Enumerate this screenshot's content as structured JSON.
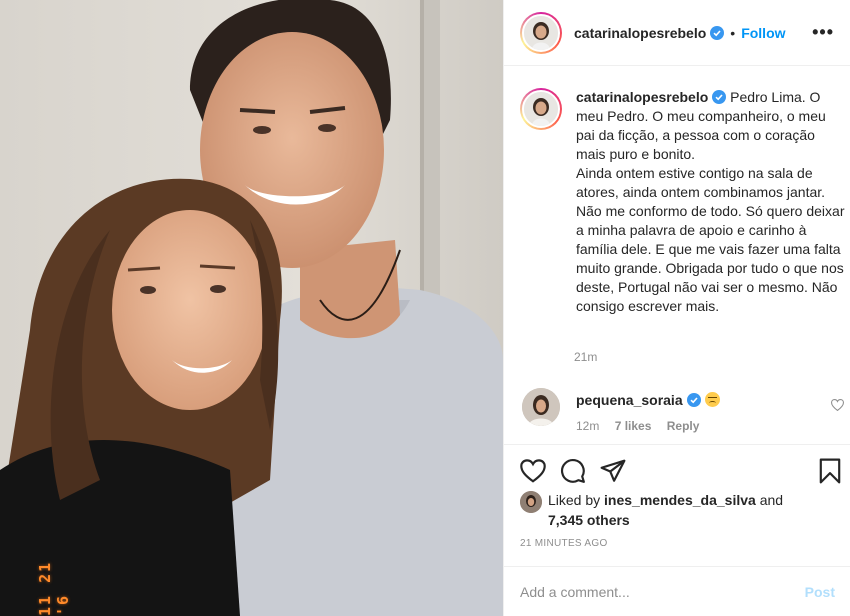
{
  "post": {
    "author": {
      "username": "catarinalopesrebelo",
      "verified": true,
      "follow_label": "Follow",
      "separator": "•",
      "more_label": "•••"
    },
    "photo": {
      "date_stamp": "11 21 '6",
      "colors": {
        "wall": "#d9d4cc",
        "shirt": "#c9ccd3",
        "hair_dark": "#2b211c",
        "hair_brown": "#5b3a24",
        "skin": "#e2b08f",
        "top_black": "#141414"
      }
    },
    "caption": {
      "username": "catarinalopesrebelo",
      "text": "Pedro Lima. O meu Pedro. O meu companheiro, o meu pai da ficção, a pessoa com o coração mais puro e bonito.",
      "text2": "Ainda ontem estive contigo na sala de atores, ainda ontem combinamos jantar. Não me conformo de todo. Só quero deixar a minha palavra de apoio e carinho à família dele. E que me vais fazer uma falta muito grande. Obrigada por tudo o que nos deste, Portugal não vai ser o mesmo. Não consigo escrever mais.",
      "time": "21m"
    },
    "comments": [
      {
        "username": "pequena_soraia",
        "verified": true,
        "emoji": "pensive-face",
        "time": "12m",
        "likes": "7 likes",
        "reply_label": "Reply"
      }
    ],
    "likes": {
      "prefix": "Liked by",
      "user": "ines_mendes_da_silva",
      "and": "and",
      "others": "7,345 others"
    },
    "time_ago": "21 MINUTES AGO",
    "add_comment": {
      "placeholder": "Add a comment...",
      "post_label": "Post"
    },
    "icons": [
      "heart-icon",
      "comment-icon",
      "share-icon",
      "bookmark-icon",
      "verified-icon"
    ],
    "accent": "#0095f6"
  }
}
